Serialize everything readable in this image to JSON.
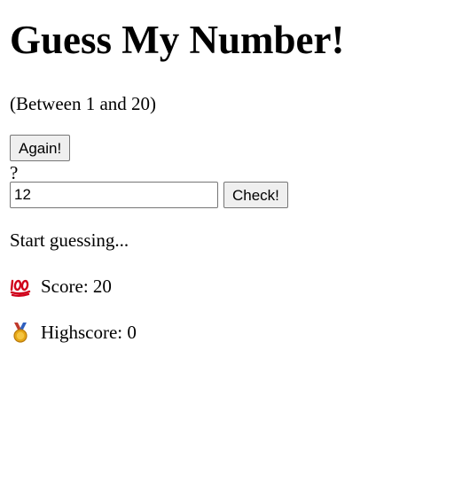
{
  "header": {
    "title": "Guess My Number!",
    "range_text": "(Between 1 and 20)"
  },
  "controls": {
    "again_label": "Again!",
    "secret_number": "?",
    "guess_value": "12",
    "check_label": "Check!"
  },
  "status": {
    "message": "Start guessing...",
    "score_label": "Score:",
    "score_value": "20",
    "highscore_label": "Highscore:",
    "highscore_value": "0",
    "score_icon": "hundred-points-icon",
    "highscore_icon": "medal-icon"
  },
  "colors": {
    "score_icon": "#d0021b",
    "medal_ribbon": "#c0392b",
    "medal_gold": "#e6a817"
  }
}
